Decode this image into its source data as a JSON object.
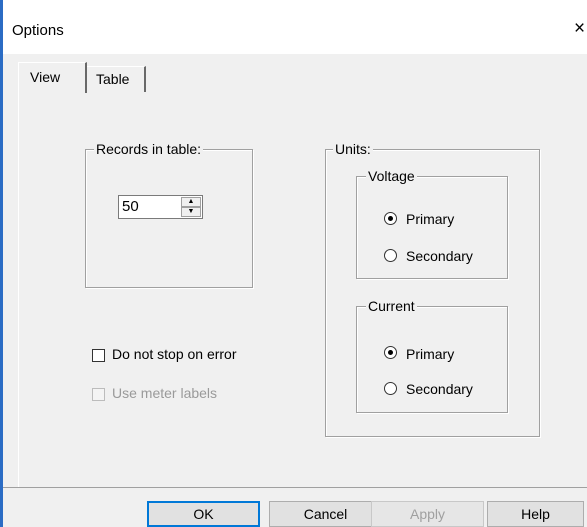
{
  "window": {
    "title": "Options",
    "close_glyph": "×"
  },
  "tabs": [
    {
      "label": "View",
      "active": true
    },
    {
      "label": "Table",
      "active": false
    }
  ],
  "records": {
    "group_label": "Records in table:",
    "value": "50"
  },
  "units": {
    "group_label": "Units:",
    "voltage": {
      "group_label": "Voltage",
      "options": [
        {
          "label": "Primary",
          "selected": true
        },
        {
          "label": "Secondary",
          "selected": false
        }
      ]
    },
    "current": {
      "group_label": "Current",
      "options": [
        {
          "label": "Primary",
          "selected": true
        },
        {
          "label": "Secondary",
          "selected": false
        }
      ]
    }
  },
  "checkboxes": [
    {
      "label": "Do not stop on error",
      "checked": false,
      "enabled": true
    },
    {
      "label": "Use meter labels",
      "checked": false,
      "enabled": false
    }
  ],
  "buttons": {
    "ok": "OK",
    "cancel": "Cancel",
    "apply": "Apply",
    "help": "Help"
  },
  "icons": {
    "spin_up": "spin-up-arrow-icon",
    "spin_down": "spin-down-arrow-icon",
    "close": "close-icon"
  }
}
